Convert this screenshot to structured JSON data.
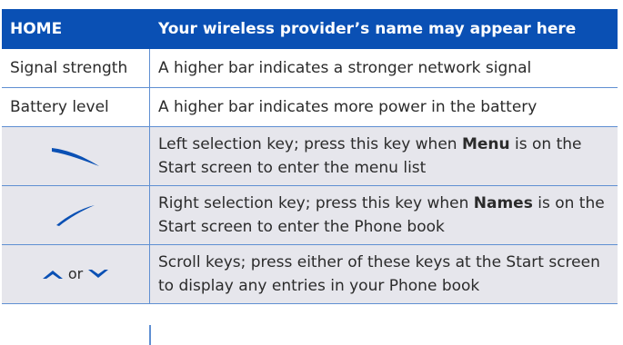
{
  "header": {
    "col1": "HOME",
    "col2": "Your wireless provider’s name may appear here"
  },
  "rows": [
    {
      "label": "Signal strength",
      "desc": "A higher bar indicates a stronger network signal"
    },
    {
      "label": "Battery level",
      "desc": "A higher bar indicates more power in the battery"
    },
    {
      "icon": "left-selection-key-icon",
      "desc_pre": "Left selection key; press this key when ",
      "desc_bold": "Menu",
      "desc_post": " is on the Start screen to enter the menu list"
    },
    {
      "icon": "right-selection-key-icon",
      "desc_pre": "Right selection key; press this key when ",
      "desc_bold": "Names",
      "desc_post": " is on the Start screen to enter the Phone book"
    },
    {
      "icon": "scroll-keys-icon",
      "or_label": "or",
      "desc": "Scroll keys; press either of these keys at the Start screen to display any entries in your Phone book"
    }
  ],
  "colors": {
    "header_bg": "#0a50b4",
    "border": "#5f8fd2",
    "icon_blue": "#0a50b4",
    "row_gray": "#e6e6ec"
  }
}
